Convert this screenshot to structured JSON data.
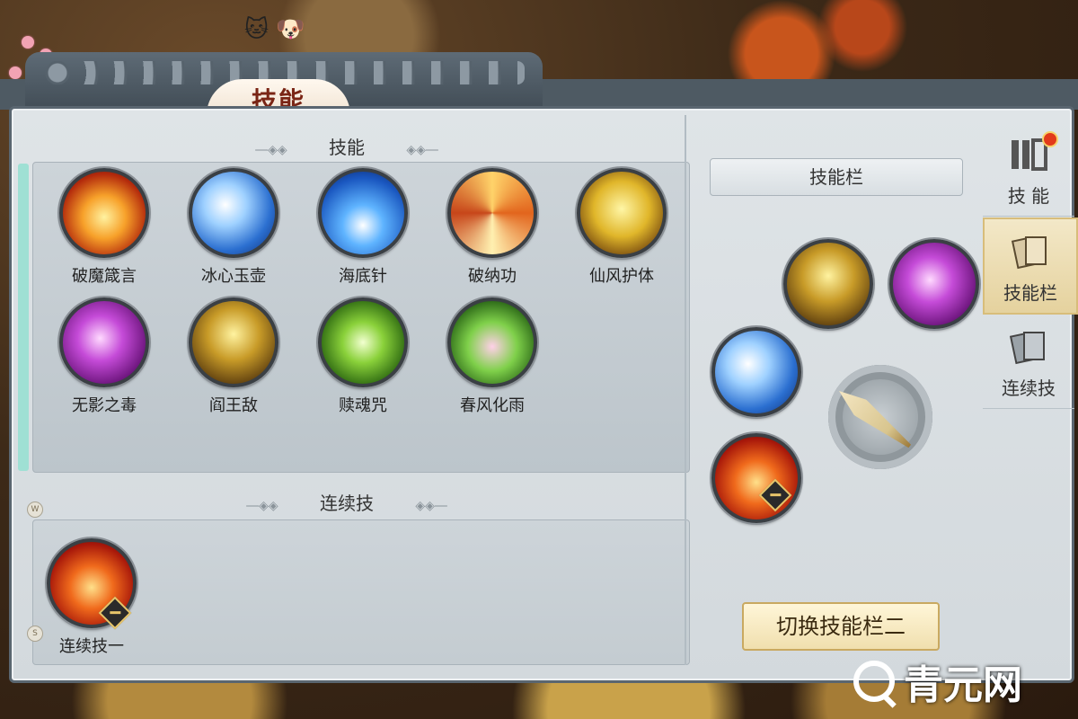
{
  "window": {
    "title": "技能"
  },
  "sections": {
    "skills_heading": "技能",
    "combo_heading": "连续技"
  },
  "skills": [
    {
      "name": "破魔箴言",
      "icon": "fire-pillar-icon"
    },
    {
      "name": "冰心玉壶",
      "icon": "water-cloud-icon"
    },
    {
      "name": "海底针",
      "icon": "wave-icon"
    },
    {
      "name": "破纳功",
      "icon": "swirl-icon"
    },
    {
      "name": "仙风护体",
      "icon": "golden-shield-icon"
    },
    {
      "name": "无影之毒",
      "icon": "purple-poison-icon"
    },
    {
      "name": "阎王敌",
      "icon": "golden-hands-icon"
    },
    {
      "name": "赎魂咒",
      "icon": "green-lotus-icon"
    },
    {
      "name": "春风化雨",
      "icon": "flower-rain-icon"
    }
  ],
  "combo": [
    {
      "name": "连续技一",
      "icon": "fire-combo-icon"
    }
  ],
  "skillbar": {
    "title": "技能栏",
    "slots": [
      "golden-hands-icon",
      "purple-poison-icon",
      "water-cloud-icon",
      "fire-combo-icon"
    ],
    "switch_label": "切换技能栏二"
  },
  "tabs": [
    {
      "label": "技 能",
      "icon": "skill-book-icon",
      "has_badge": true
    },
    {
      "label": "技能栏",
      "icon": "skill-cards-icon",
      "active": true
    },
    {
      "label": "连续技",
      "icon": "combo-cards-icon"
    }
  ],
  "hints": {
    "top": "W",
    "bottom": "S"
  },
  "watermark": "青元网",
  "colors": {
    "accent": "#9fe0d4",
    "button_bg": "#f0dfae",
    "title_red": "#7a2515"
  }
}
